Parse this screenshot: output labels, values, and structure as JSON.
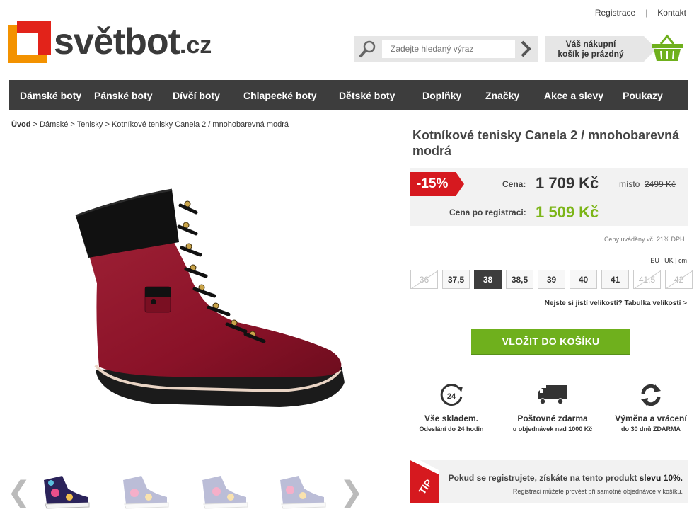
{
  "header": {
    "links": [
      "Registrace",
      "Kontakt"
    ],
    "logo": {
      "name": "světbot",
      "tld": ".cz"
    },
    "search": {
      "placeholder": "Zadejte hledaný výraz"
    },
    "cart": {
      "line1": "Váš nákupní",
      "line2": "košík je prázdný"
    }
  },
  "nav": [
    "Dámské boty",
    "Pánské boty",
    "Dívčí boty",
    "Chlapecké boty",
    "Dětské boty",
    "Doplňky",
    "Značky",
    "Akce a slevy",
    "Poukazy"
  ],
  "breadcrumb": {
    "home": "Úvod",
    "rest": " > Dámské > Tenisky > Kotníkové tenisky Canela 2 / mnohobarevná modrá"
  },
  "product": {
    "title": "Kotníkové tenisky Canela 2 / mnohobarevná modrá",
    "discount": "-15%",
    "price_label": "Cena:",
    "price": "1 709 Kč",
    "old_label": "místo",
    "old_price": "2499 Kč",
    "reg_label": "Cena po registraci:",
    "reg_price": "1 509 Kč",
    "vat_note": "Ceny uváděny vč. 21% DPH.",
    "size_units": "EU | UK | cm",
    "sizes": [
      {
        "label": "36",
        "state": "unavailable"
      },
      {
        "label": "37,5",
        "state": "available"
      },
      {
        "label": "38",
        "state": "selected"
      },
      {
        "label": "38,5",
        "state": "available"
      },
      {
        "label": "39",
        "state": "available"
      },
      {
        "label": "40",
        "state": "available"
      },
      {
        "label": "41",
        "state": "available"
      },
      {
        "label": "41,5",
        "state": "unavailable"
      },
      {
        "label": "42",
        "state": "unavailable"
      }
    ],
    "size_help": "Nejste si jistí velikostí? Tabulka velikostí >",
    "add_to_cart": "VLOŽIT DO KOŠÍKU"
  },
  "features": [
    {
      "icon": "clock-24-icon",
      "title": "Vše skladem.",
      "sub": "Odeslání do 24 hodin"
    },
    {
      "icon": "truck-icon",
      "title": "Poštovné zdarma",
      "sub": "u objednávek nad 1000 Kč"
    },
    {
      "icon": "refresh-icon",
      "title": "Výměna a vrácení",
      "sub": "do 30 dnů ZDARMA"
    }
  ],
  "tip": {
    "badge": "TIP",
    "main_prefix": "Pokud se registrujete, získáte na tento produkt ",
    "main_highlight": "slevu 10%.",
    "sub": "Registraci můžete provést při samotné objednávce v košíku."
  },
  "colors": {
    "accent_green": "#6fb01d",
    "discount_red": "#d6191f",
    "nav_bg": "#3d3d3d",
    "logo_orange": "#f39200"
  }
}
